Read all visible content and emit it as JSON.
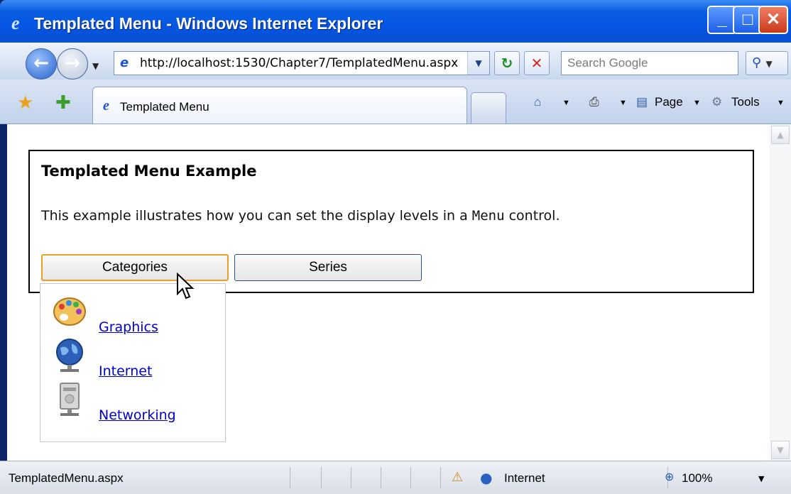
{
  "window": {
    "title": "Templated Menu - Windows Internet Explorer"
  },
  "address": {
    "url": "http://localhost:1530/Chapter7/TemplatedMenu.aspx"
  },
  "search": {
    "placeholder": "Search Google"
  },
  "tab": {
    "label": "Templated Menu"
  },
  "toolbar": {
    "page_label": "Page",
    "tools_label": "Tools"
  },
  "page": {
    "heading": "Templated Menu Example",
    "description_before": "This example illustrates how you can set the display levels in a ",
    "description_code": "Menu",
    "description_after": " control."
  },
  "menu": {
    "items": [
      {
        "label": "Categories",
        "active": true
      },
      {
        "label": "Series",
        "active": false
      }
    ],
    "submenu": [
      {
        "label": "Graphics",
        "icon": "palette-icon"
      },
      {
        "label": "Internet",
        "icon": "globe-icon"
      },
      {
        "label": "Networking",
        "icon": "server-icon"
      }
    ]
  },
  "status": {
    "text": "TemplatedMenu.aspx",
    "zone": "Internet",
    "zoom": "100%"
  }
}
